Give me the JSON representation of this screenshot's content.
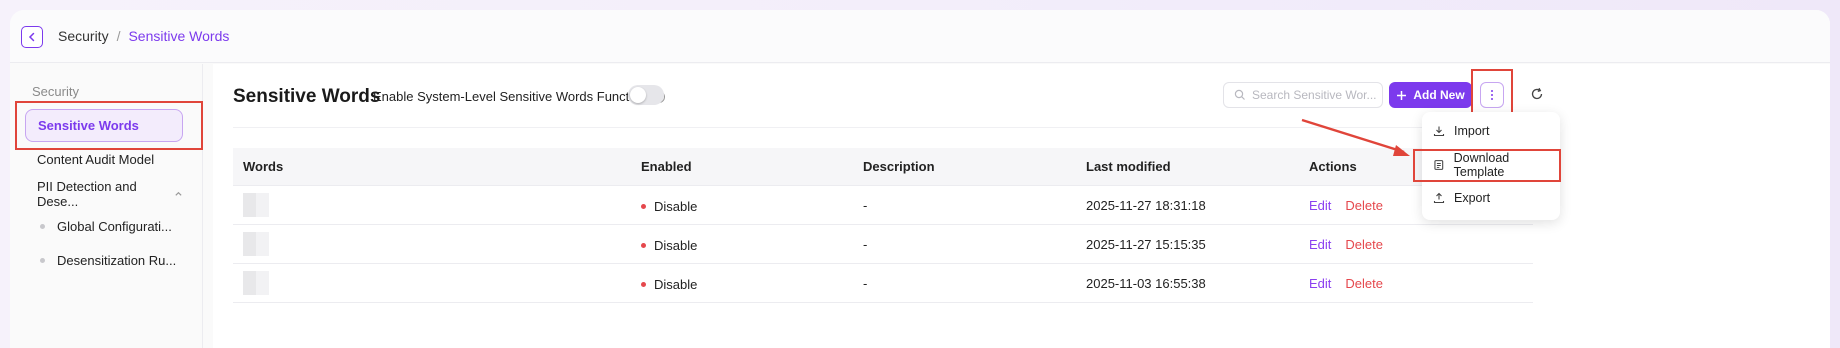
{
  "breadcrumb": {
    "parent": "Security",
    "separator": "/",
    "current": "Sensitive Words"
  },
  "sidebar": {
    "group_label": "Security",
    "items": [
      {
        "label": "Sensitive Words",
        "active": true
      },
      {
        "label": "Content Audit Model",
        "active": false
      },
      {
        "label": "PII Detection and Dese...",
        "active": false,
        "expanded": true
      }
    ],
    "sub_items": [
      {
        "label": "Global Configurati..."
      },
      {
        "label": "Desensitization Ru..."
      }
    ]
  },
  "page": {
    "title": "Sensitive Words",
    "toggle_label": "Enable System-Level Sensitive Words Function",
    "toggle_on": false
  },
  "toolbar": {
    "search_placeholder": "Search Sensitive Wor...",
    "add_new": "Add New"
  },
  "table": {
    "columns": [
      "Words",
      "Enabled",
      "Description",
      "Last modified",
      "Actions"
    ],
    "rows": [
      {
        "status": "Disable",
        "description": "-",
        "modified": "2025-11-27 18:31:18",
        "edit": "Edit",
        "delete": "Delete"
      },
      {
        "status": "Disable",
        "description": "-",
        "modified": "2025-11-27 15:15:35",
        "edit": "Edit",
        "delete": "Delete"
      },
      {
        "status": "Disable",
        "description": "-",
        "modified": "2025-11-03 16:55:38",
        "edit": "Edit",
        "delete": "Delete"
      }
    ]
  },
  "dropdown": {
    "items": [
      {
        "label": "Import",
        "icon": "download-icon"
      },
      {
        "label": "Download Template",
        "icon": "template-icon"
      },
      {
        "label": "Export",
        "icon": "export-icon"
      }
    ]
  },
  "colors": {
    "accent": "#7c3aed",
    "danger": "#e5484d",
    "annotation": "#e0453a"
  }
}
